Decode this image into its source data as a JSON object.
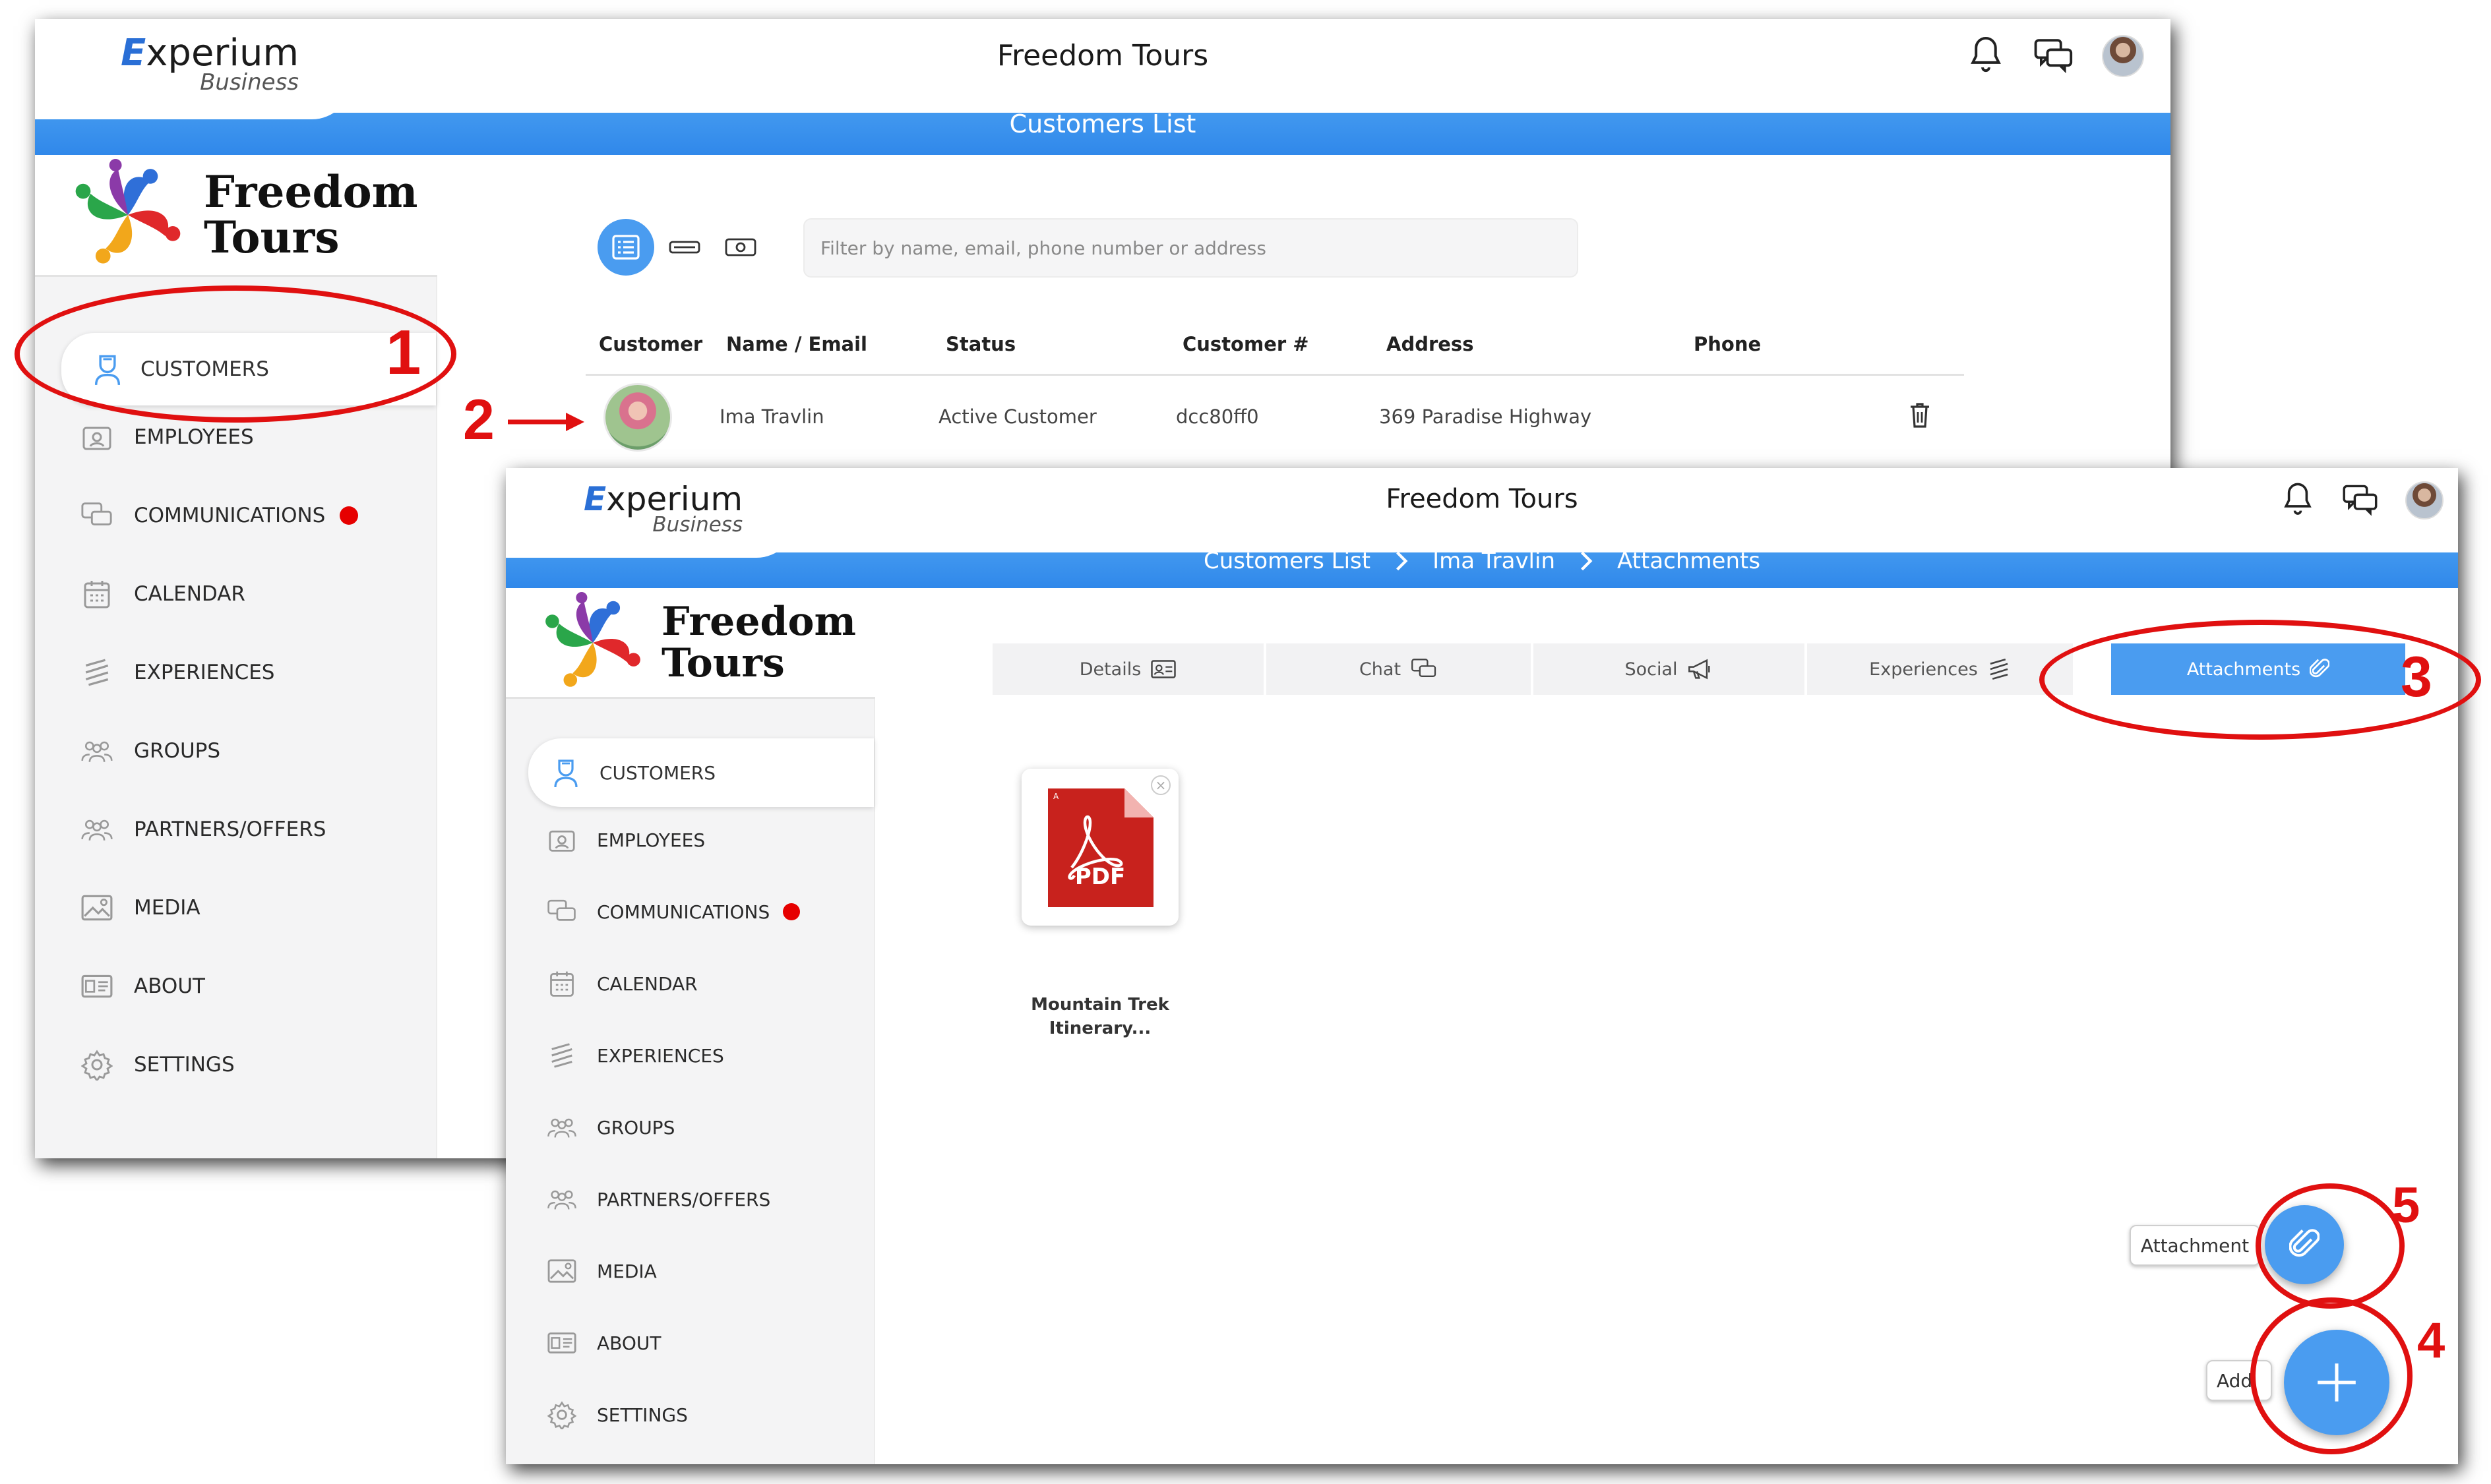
{
  "app": {
    "title": "Freedom Tours"
  },
  "logo": {
    "xp_initial": "E",
    "xp_word": "xperium",
    "xp_sub": "Business"
  },
  "brand": {
    "line1": "Freedom",
    "line2": "Tours"
  },
  "window1": {
    "band_title": "Customers List",
    "nav": [
      {
        "label": "CUSTOMERS",
        "icon": "customer-icon"
      },
      {
        "label": "EMPLOYEES",
        "icon": "badge-icon"
      },
      {
        "label": "COMMUNICATIONS",
        "icon": "chat-icon"
      },
      {
        "label": "CALENDAR",
        "icon": "calendar-icon"
      },
      {
        "label": "EXPERIENCES",
        "icon": "layers-icon"
      },
      {
        "label": "GROUPS",
        "icon": "group-icon"
      },
      {
        "label": "PARTNERS/OFFERS",
        "icon": "partners-icon"
      },
      {
        "label": "MEDIA",
        "icon": "image-icon"
      },
      {
        "label": "ABOUT",
        "icon": "id-card-icon"
      },
      {
        "label": "SETTINGS",
        "icon": "gear-icon"
      }
    ],
    "filter_placeholder": "Filter by name, email, phone number or address",
    "table": {
      "headers": [
        "Customer",
        "Name / Email",
        "Status",
        "Customer #",
        "Address",
        "Phone"
      ],
      "row": {
        "name": "Ima Travlin",
        "status": "Active Customer",
        "number": "dcc80ff0",
        "address": "369 Paradise Highway",
        "phone": ""
      }
    }
  },
  "window2": {
    "breadcrumb": [
      "Customers List",
      "Ima Travlin",
      "Attachments"
    ],
    "tabs": [
      "Details",
      "Chat",
      "Social",
      "Experiences",
      "Attachments"
    ],
    "file": {
      "badge": "PDF",
      "name_line1": "Mountain Trek",
      "name_line2": "Itinerary..."
    },
    "fab_attachment_label": "Attachment",
    "fab_add_label": "Add"
  },
  "callouts": [
    "1",
    "2",
    "3",
    "4",
    "5"
  ],
  "colors": {
    "accent": "#4a9cf0",
    "callout": "#e01010",
    "notification_dot": "#e60000",
    "pdf_red": "#c8221d"
  }
}
